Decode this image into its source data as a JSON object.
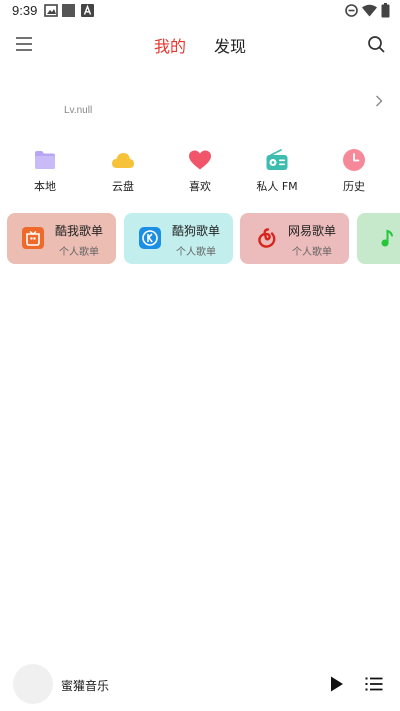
{
  "status_bar": {
    "time": "9:39",
    "icons": [
      "gallery-icon",
      "square-icon",
      "a-badge-icon",
      "do-not-disturb-icon",
      "wifi-icon",
      "battery-icon"
    ]
  },
  "header": {
    "menu_icon": "menu-icon",
    "tabs": [
      {
        "label": "我的",
        "active": true
      },
      {
        "label": "发现",
        "active": false
      }
    ],
    "search_icon": "search-icon",
    "active_color": "#e8362d"
  },
  "profile": {
    "level": "Lv.null",
    "chevron_icon": "chevron-right-icon"
  },
  "quick_nav": [
    {
      "label": "本地",
      "icon": "folder-icon",
      "color": "#b8a6f5"
    },
    {
      "label": "云盘",
      "icon": "cloud-icon",
      "color": "#f6c23a"
    },
    {
      "label": "喜欢",
      "icon": "heart-icon",
      "color": "#f0556a"
    },
    {
      "label": "私人 FM",
      "icon": "radio-icon",
      "color": "#3dbdb0"
    },
    {
      "label": "历史",
      "icon": "clock-icon",
      "color": "#f5899a"
    }
  ],
  "playlists": [
    {
      "title": "酷我歌单",
      "subtitle": "个人歌单",
      "icon": "kuwo-icon",
      "bg": "#ebbdb3"
    },
    {
      "title": "酷狗歌单",
      "subtitle": "个人歌单",
      "icon": "kugou-icon",
      "bg": "#c2eeee"
    },
    {
      "title": "网易歌单",
      "subtitle": "个人歌单",
      "icon": "netease-icon",
      "bg": "#ecbcbc"
    },
    {
      "title": "",
      "subtitle": "",
      "icon": "qq-music-icon",
      "bg": "#c6e8cb"
    }
  ],
  "player": {
    "title": "蜜獾音乐",
    "play_icon": "play-icon",
    "queue_icon": "playlist-icon"
  }
}
